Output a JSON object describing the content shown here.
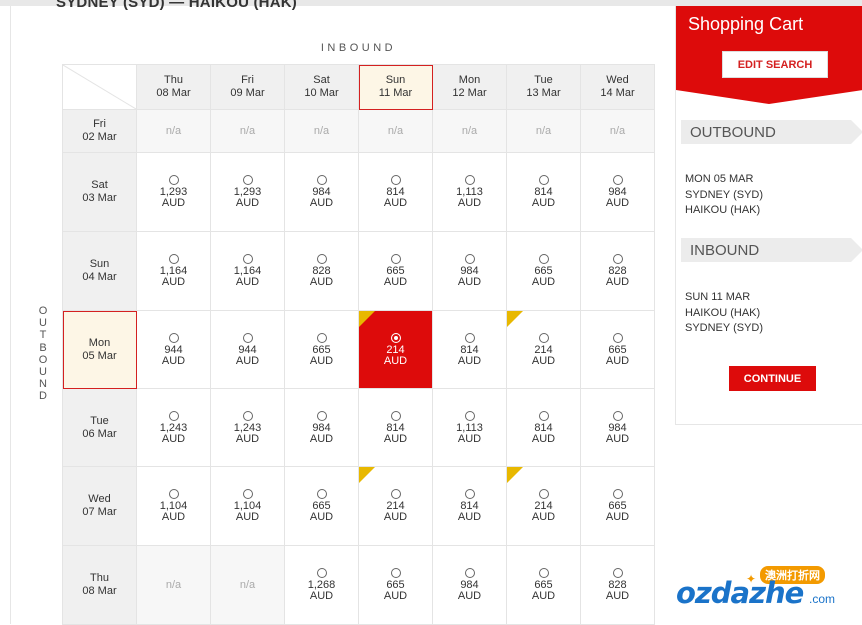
{
  "route": "SYDNEY (SYD) — HAIKOU (HAK)",
  "inbound_label": "INBOUND",
  "outbound_label": "OUTBOUND",
  "columns": [
    {
      "day": "Thu",
      "date": "08 Mar"
    },
    {
      "day": "Fri",
      "date": "09 Mar"
    },
    {
      "day": "Sat",
      "date": "10 Mar"
    },
    {
      "day": "Sun",
      "date": "11 Mar"
    },
    {
      "day": "Mon",
      "date": "12 Mar"
    },
    {
      "day": "Tue",
      "date": "13 Mar"
    },
    {
      "day": "Wed",
      "date": "14 Mar"
    }
  ],
  "rows": [
    {
      "day": "Fri",
      "date": "02 Mar",
      "cells": [
        {
          "na": "n/a"
        },
        {
          "na": "n/a"
        },
        {
          "na": "n/a"
        },
        {
          "na": "n/a"
        },
        {
          "na": "n/a"
        },
        {
          "na": "n/a"
        },
        {
          "na": "n/a"
        }
      ]
    },
    {
      "day": "Sat",
      "date": "03 Mar",
      "cells": [
        {
          "price": "1,293",
          "cur": "AUD"
        },
        {
          "price": "1,293",
          "cur": "AUD"
        },
        {
          "price": "984",
          "cur": "AUD"
        },
        {
          "price": "814",
          "cur": "AUD"
        },
        {
          "price": "1,113",
          "cur": "AUD"
        },
        {
          "price": "814",
          "cur": "AUD"
        },
        {
          "price": "984",
          "cur": "AUD"
        }
      ]
    },
    {
      "day": "Sun",
      "date": "04 Mar",
      "cells": [
        {
          "price": "1,164",
          "cur": "AUD"
        },
        {
          "price": "1,164",
          "cur": "AUD"
        },
        {
          "price": "828",
          "cur": "AUD"
        },
        {
          "price": "665",
          "cur": "AUD"
        },
        {
          "price": "984",
          "cur": "AUD"
        },
        {
          "price": "665",
          "cur": "AUD"
        },
        {
          "price": "828",
          "cur": "AUD"
        }
      ]
    },
    {
      "day": "Mon",
      "date": "05 Mar",
      "cells": [
        {
          "price": "944",
          "cur": "AUD"
        },
        {
          "price": "944",
          "cur": "AUD"
        },
        {
          "price": "665",
          "cur": "AUD"
        },
        {
          "price": "214",
          "cur": "AUD",
          "promo": true,
          "selected": true
        },
        {
          "price": "814",
          "cur": "AUD"
        },
        {
          "price": "214",
          "cur": "AUD",
          "promo": true
        },
        {
          "price": "665",
          "cur": "AUD"
        }
      ]
    },
    {
      "day": "Tue",
      "date": "06 Mar",
      "cells": [
        {
          "price": "1,243",
          "cur": "AUD"
        },
        {
          "price": "1,243",
          "cur": "AUD"
        },
        {
          "price": "984",
          "cur": "AUD"
        },
        {
          "price": "814",
          "cur": "AUD"
        },
        {
          "price": "1,113",
          "cur": "AUD"
        },
        {
          "price": "814",
          "cur": "AUD"
        },
        {
          "price": "984",
          "cur": "AUD"
        }
      ]
    },
    {
      "day": "Wed",
      "date": "07 Mar",
      "cells": [
        {
          "price": "1,104",
          "cur": "AUD"
        },
        {
          "price": "1,104",
          "cur": "AUD"
        },
        {
          "price": "665",
          "cur": "AUD"
        },
        {
          "price": "214",
          "cur": "AUD",
          "promo": true
        },
        {
          "price": "814",
          "cur": "AUD"
        },
        {
          "price": "214",
          "cur": "AUD",
          "promo": true
        },
        {
          "price": "665",
          "cur": "AUD"
        }
      ]
    },
    {
      "day": "Thu",
      "date": "08 Mar",
      "cells": [
        {
          "na": "n/a"
        },
        {
          "na": "n/a"
        },
        {
          "price": "1,268",
          "cur": "AUD"
        },
        {
          "price": "665",
          "cur": "AUD"
        },
        {
          "price": "984",
          "cur": "AUD"
        },
        {
          "price": "665",
          "cur": "AUD"
        },
        {
          "price": "828",
          "cur": "AUD"
        }
      ]
    }
  ],
  "selected_column": 3,
  "selected_row": 3,
  "cart": {
    "title": "Shopping Cart",
    "edit_label": "EDIT SEARCH",
    "outbound_title": "OUTBOUND",
    "outbound_lines": [
      "MON 05 MAR",
      "SYDNEY (SYD)",
      "HAIKOU (HAK)"
    ],
    "inbound_title": "INBOUND",
    "inbound_lines": [
      "SUN 11 MAR",
      "HAIKOU (HAK)",
      "SYDNEY (SYD)"
    ],
    "continue_label": "CONTINUE"
  },
  "logo": {
    "text": "ozdazhe",
    "com": ".com",
    "badge": "澳洲打折网"
  },
  "colors": {
    "brand_red": "#dd0b0b",
    "promo_yellow": "#e8b800",
    "logo_blue": "#1a73c9"
  }
}
